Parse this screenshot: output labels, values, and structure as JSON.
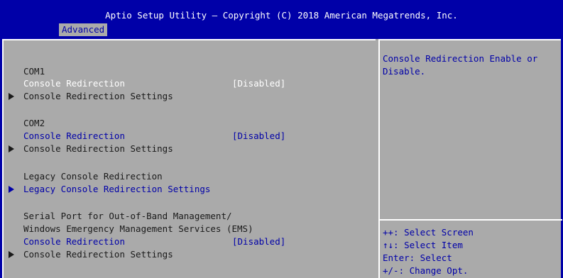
{
  "header": {
    "title": "Aptio Setup Utility – Copyright (C) 2018 American Megatrends, Inc.",
    "tab": "Advanced"
  },
  "main": {
    "com1_heading": "COM1",
    "com1_redirection_label": "Console Redirection",
    "com1_redirection_value": "[Disabled]",
    "com1_settings": "Console Redirection Settings",
    "com2_heading": "COM2",
    "com2_redirection_label": "Console Redirection",
    "com2_redirection_value": "[Disabled]",
    "com2_settings": "Console Redirection Settings",
    "legacy_heading": "Legacy Console Redirection",
    "legacy_settings": "Legacy Console Redirection Settings",
    "ems_heading_1": "Serial Port for Out-of-Band Management/",
    "ems_heading_2": "Windows Emergency Management Services (EMS)",
    "ems_redirection_label": "Console Redirection",
    "ems_redirection_value": "[Disabled]",
    "ems_settings": "Console Redirection Settings"
  },
  "help": {
    "line1": "Console Redirection Enable or",
    "line2": "Disable."
  },
  "keys": {
    "select_screen": "++: Select Screen",
    "select_item": "↑↓: Select Item",
    "enter": "Enter: Select",
    "change": "+/-: Change Opt."
  },
  "colors": {
    "background": "#0000a8",
    "panel": "#aaaaaa",
    "text_dark": "#1a1a1a",
    "text_highlight": "#ffffff",
    "text_blue": "#0000a8"
  }
}
